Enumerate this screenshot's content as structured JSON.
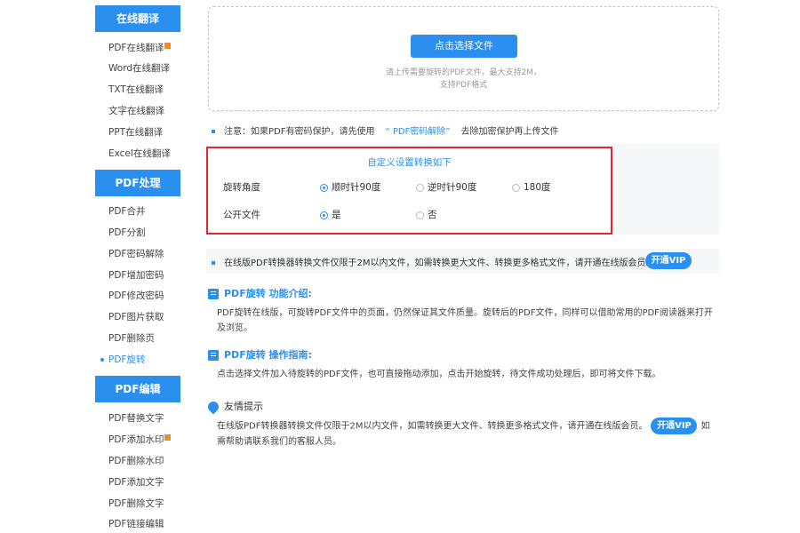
{
  "sidebar": {
    "section1": {
      "title": "在线翻译",
      "items": [
        {
          "label": "PDF在线翻译",
          "badge": true
        },
        {
          "label": "Word在线翻译"
        },
        {
          "label": "TXT在线翻译"
        },
        {
          "label": "文字在线翻译"
        },
        {
          "label": "PPT在线翻译"
        },
        {
          "label": "Excel在线翻译"
        }
      ]
    },
    "section2": {
      "title": "PDF处理",
      "items": [
        {
          "label": "PDF合并"
        },
        {
          "label": "PDF分割"
        },
        {
          "label": "PDF密码解除"
        },
        {
          "label": "PDF增加密码"
        },
        {
          "label": "PDF修改密码"
        },
        {
          "label": "PDF图片获取"
        },
        {
          "label": "PDF删除页"
        },
        {
          "label": "PDF旋转",
          "active": true
        }
      ]
    },
    "section3": {
      "title": "PDF编辑",
      "items": [
        {
          "label": "PDF替换文字"
        },
        {
          "label": "PDF添加水印",
          "badge": true
        },
        {
          "label": "PDF删除水印"
        },
        {
          "label": "PDF添加文字"
        },
        {
          "label": "PDF删除文字"
        },
        {
          "label": "PDF链接编辑"
        }
      ]
    }
  },
  "upload": {
    "button_label": "点击选择文件",
    "hint_line1": "请上传需要旋转的PDF文件，最大支持2M，",
    "hint_line2": "支持PDF格式"
  },
  "note": {
    "prefix": "注意：如果PDF有密码保护，请先使用",
    "link": "“ PDF密码解除”",
    "suffix": "去除加密保护再上传文件"
  },
  "settings": {
    "title": "自定义设置转换如下",
    "rotation_label": "旋转角度",
    "rotation_options": [
      "顺时针90度",
      "逆时针90度",
      "180度"
    ],
    "rotation_selected": 0,
    "public_label": "公开文件",
    "public_options": [
      "是",
      "否"
    ],
    "public_selected": 0
  },
  "vip_banner": {
    "text": "在线版PDF转换器转换文件仅限于2M以内文件，如需转换更大文件、转换更多格式文件，请开通在线版会员。",
    "button": "开通VIP"
  },
  "intro": {
    "title": "PDF旋转 功能介绍:",
    "body": "PDF旋转在线版，可旋转PDF文件中的页面，仍然保证其文件质量。旋转后的PDF文件，同样可以借助常用的PDF阅读器来打开及浏览。"
  },
  "guide": {
    "title": "PDF旋转 操作指南:",
    "body": "点击选择文件加入待旋转的PDF文件，也可直接拖动添加，点击开始旋转，待文件成功处理后，即可将文件下载。"
  },
  "tips": {
    "title": "友情提示",
    "body_part1": "在线版PDF转换器转换文件仅限于2M以内文件，如需转换更大文件、转换更多格式文件，请开通在线版会员。",
    "button": "开通VIP",
    "body_part2": "如需帮助请联系我们的客服人员。"
  },
  "colors": {
    "accent": "#2b8ff0",
    "highlight_border": "#e6262b",
    "badge": "#f08b2b"
  }
}
